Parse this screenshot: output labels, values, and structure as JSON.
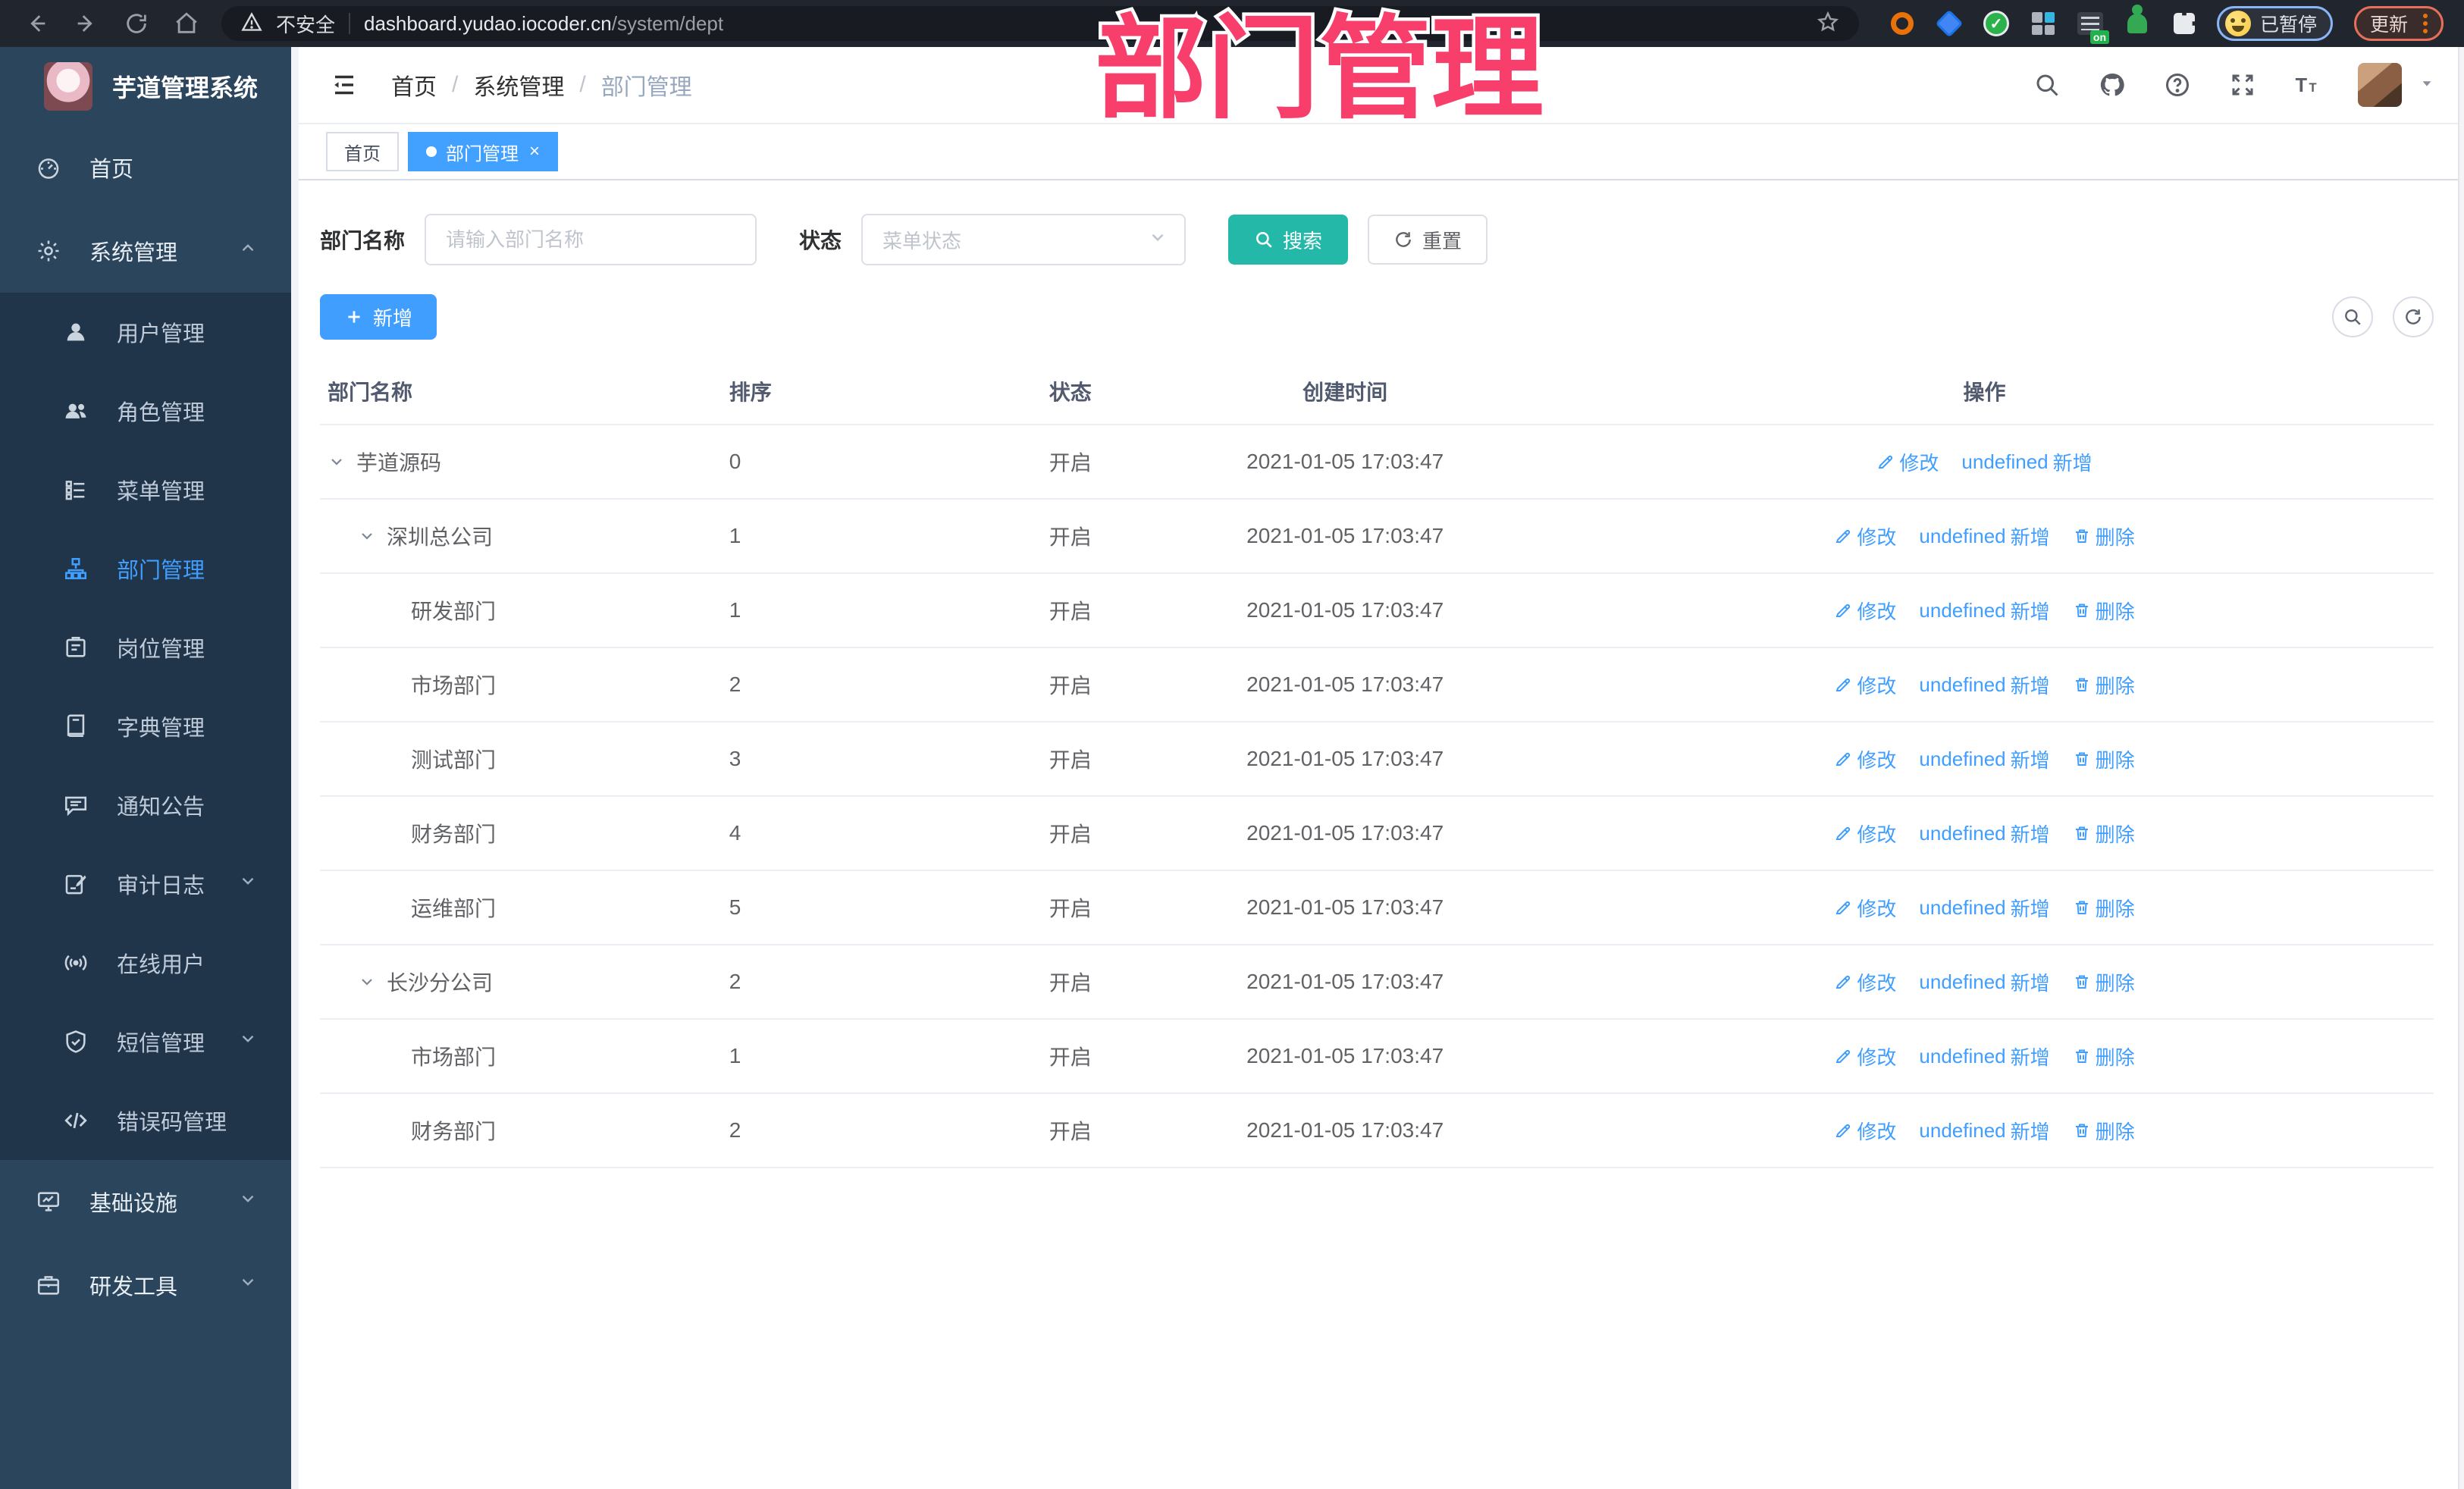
{
  "overlay": {
    "title": "部门管理",
    "color": "#f83e6b"
  },
  "browser": {
    "security_label": "不安全",
    "url_host": "dashboard.yudao.iocoder.cn",
    "url_path": "/system/dept",
    "profile_chip_label": "已暂停",
    "update_button_label": "更新",
    "extension_badge": "on"
  },
  "sidebar": {
    "logo_title": "芋道管理系统",
    "items": [
      {
        "label": "首页",
        "icon": "dashboard-icon",
        "kind": "top"
      },
      {
        "label": "系统管理",
        "icon": "gear-icon",
        "kind": "top",
        "arrow": "up"
      },
      {
        "label": "用户管理",
        "icon": "user-icon",
        "kind": "sub"
      },
      {
        "label": "角色管理",
        "icon": "users-icon",
        "kind": "sub"
      },
      {
        "label": "菜单管理",
        "icon": "menu-list-icon",
        "kind": "sub"
      },
      {
        "label": "部门管理",
        "icon": "org-tree-icon",
        "kind": "sub",
        "active": true
      },
      {
        "label": "岗位管理",
        "icon": "badge-icon",
        "kind": "sub"
      },
      {
        "label": "字典管理",
        "icon": "dictionary-icon",
        "kind": "sub"
      },
      {
        "label": "通知公告",
        "icon": "announcement-icon",
        "kind": "sub"
      },
      {
        "label": "审计日志",
        "icon": "audit-log-icon",
        "kind": "sub",
        "arrow": "down"
      },
      {
        "label": "在线用户",
        "icon": "online-users-icon",
        "kind": "sub"
      },
      {
        "label": "短信管理",
        "icon": "sms-shield-icon",
        "kind": "sub",
        "arrow": "down"
      },
      {
        "label": "错误码管理",
        "icon": "error-code-icon",
        "kind": "sub"
      },
      {
        "label": "基础设施",
        "icon": "infrastructure-icon",
        "kind": "top",
        "arrow": "down"
      },
      {
        "label": "研发工具",
        "icon": "devtools-icon",
        "kind": "top",
        "arrow": "down"
      }
    ]
  },
  "header": {
    "breadcrumb": [
      "首页",
      "系统管理",
      "部门管理"
    ]
  },
  "tabs": [
    {
      "label": "首页",
      "active": false
    },
    {
      "label": "部门管理",
      "active": true
    }
  ],
  "filter": {
    "name_label": "部门名称",
    "name_placeholder": "请输入部门名称",
    "status_label": "状态",
    "status_placeholder": "菜单状态",
    "search_label": "搜索",
    "reset_label": "重置"
  },
  "toolbar": {
    "add_label": "新增"
  },
  "table": {
    "headers": [
      "部门名称",
      "排序",
      "状态",
      "创建时间",
      "操作"
    ],
    "action_labels": {
      "edit": "修改",
      "add": "新增",
      "delete": "删除"
    },
    "rows": [
      {
        "name": "芋道源码",
        "level": 0,
        "caret": true,
        "sort": "0",
        "status": "开启",
        "time": "2021-01-05 17:03:47",
        "actions": [
          "edit",
          "add"
        ]
      },
      {
        "name": "深圳总公司",
        "level": 1,
        "caret": true,
        "sort": "1",
        "status": "开启",
        "time": "2021-01-05 17:03:47",
        "actions": [
          "edit",
          "add",
          "delete"
        ]
      },
      {
        "name": "研发部门",
        "level": 2,
        "caret": false,
        "sort": "1",
        "status": "开启",
        "time": "2021-01-05 17:03:47",
        "actions": [
          "edit",
          "add",
          "delete"
        ]
      },
      {
        "name": "市场部门",
        "level": 2,
        "caret": false,
        "sort": "2",
        "status": "开启",
        "time": "2021-01-05 17:03:47",
        "actions": [
          "edit",
          "add",
          "delete"
        ]
      },
      {
        "name": "测试部门",
        "level": 2,
        "caret": false,
        "sort": "3",
        "status": "开启",
        "time": "2021-01-05 17:03:47",
        "actions": [
          "edit",
          "add",
          "delete"
        ]
      },
      {
        "name": "财务部门",
        "level": 2,
        "caret": false,
        "sort": "4",
        "status": "开启",
        "time": "2021-01-05 17:03:47",
        "actions": [
          "edit",
          "add",
          "delete"
        ]
      },
      {
        "name": "运维部门",
        "level": 2,
        "caret": false,
        "sort": "5",
        "status": "开启",
        "time": "2021-01-05 17:03:47",
        "actions": [
          "edit",
          "add",
          "delete"
        ]
      },
      {
        "name": "长沙分公司",
        "level": 1,
        "caret": true,
        "sort": "2",
        "status": "开启",
        "time": "2021-01-05 17:03:47",
        "actions": [
          "edit",
          "add",
          "delete"
        ]
      },
      {
        "name": "市场部门",
        "level": 2,
        "caret": false,
        "sort": "1",
        "status": "开启",
        "time": "2021-01-05 17:03:47",
        "actions": [
          "edit",
          "add",
          "delete"
        ]
      },
      {
        "name": "财务部门",
        "level": 2,
        "caret": false,
        "sort": "2",
        "status": "开启",
        "time": "2021-01-05 17:03:47",
        "actions": [
          "edit",
          "add",
          "delete"
        ]
      }
    ]
  }
}
